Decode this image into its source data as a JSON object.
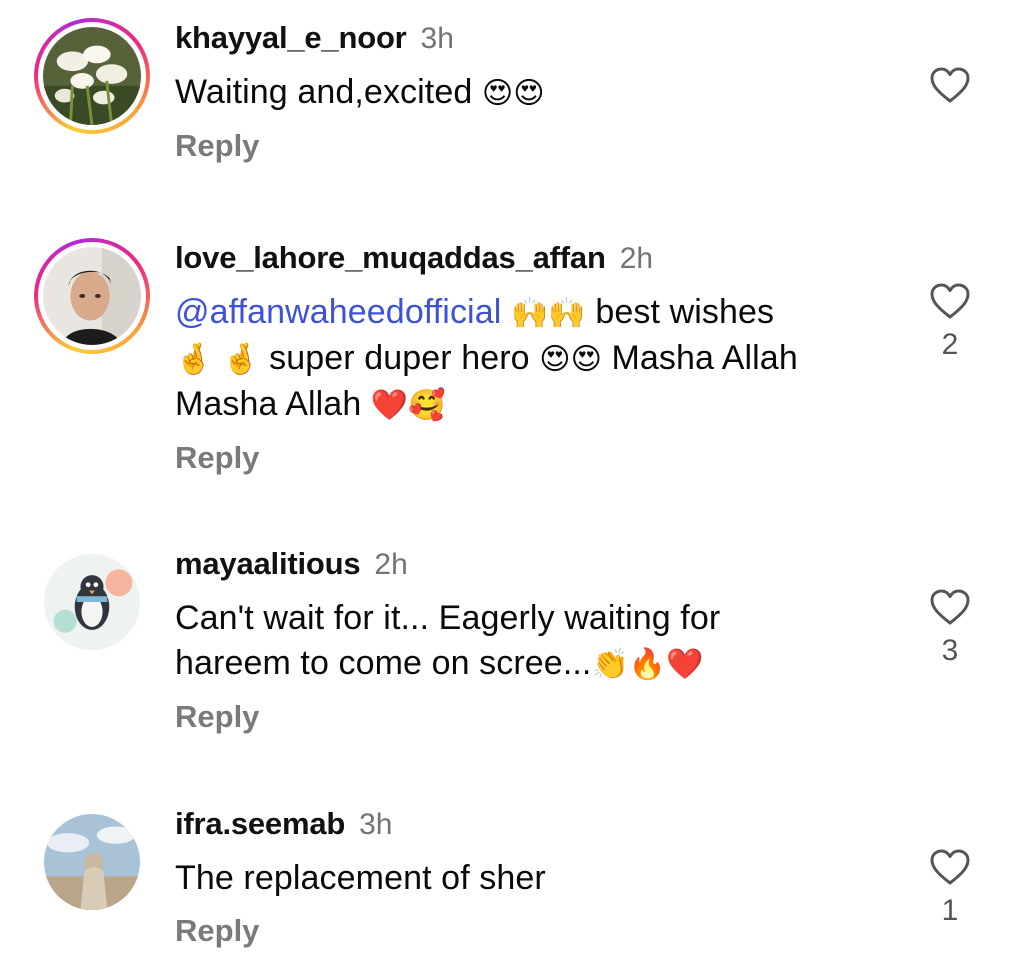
{
  "comments": [
    {
      "username": "khayyal_e_noor",
      "time": "3h",
      "text": "Waiting and,excited ",
      "emojis": "😍😍",
      "reply_label": "Reply",
      "likes": ""
    },
    {
      "username": "love_lahore_muqaddas_affan",
      "time": "2h",
      "mention": "@affanwaheedofficial",
      "emoji1": "🙌🙌",
      "text1": " best wishes",
      "emoji2": "🤞 🤞",
      "text2": " super duper hero ",
      "emoji3": "😍😍",
      "text3": " Masha Allah Masha Allah ",
      "emoji4": "❤️🥰",
      "reply_label": "Reply",
      "likes": "2"
    },
    {
      "username": "mayaalitious",
      "time": "2h",
      "text": "Can't wait for it... Eagerly waiting for hareem to come on scree...",
      "emojis": "👏🔥❤️",
      "reply_label": "Reply",
      "likes": "3"
    },
    {
      "username": "ifra.seemab",
      "time": "3h",
      "text": "The replacement of sher",
      "reply_label": "Reply",
      "likes": "1"
    }
  ],
  "icons": {
    "like": "heart-outline-icon"
  },
  "colors": {
    "mention": "#3f51d8",
    "secondary_text": "#737373",
    "story_ring_start": "#f9ce34",
    "story_ring_mid": "#ee2a7b"
  }
}
